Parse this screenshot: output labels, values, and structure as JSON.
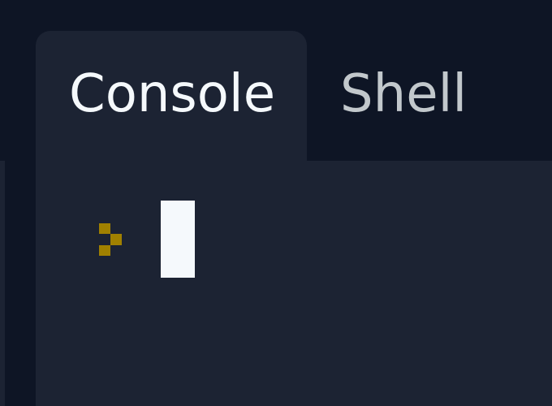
{
  "tabs": [
    {
      "label": "Console",
      "active": true
    },
    {
      "label": "Shell",
      "active": false
    }
  ],
  "console": {
    "prompt_icon": "prompt-chevron-icon",
    "input_value": ""
  },
  "colors": {
    "background": "#0e1525",
    "panel": "#1c2333",
    "active_tab_text": "#f5f9fc",
    "inactive_tab_text": "#c2c8cc",
    "prompt_accent": "#a08000",
    "cursor": "#f5f9fc"
  }
}
